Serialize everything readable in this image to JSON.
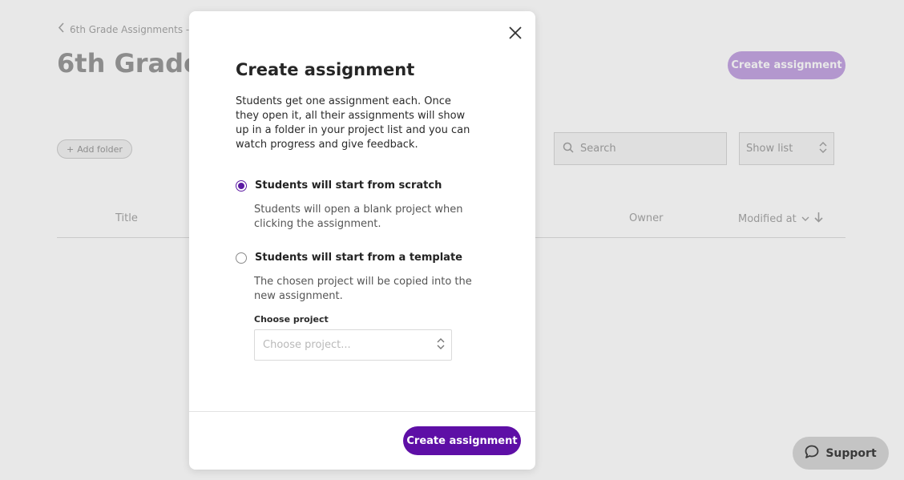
{
  "background": {
    "breadcrumb": "6th Grade Assignments - S",
    "page_title": "6th Grade -",
    "create_button": "Create assignment",
    "add_folder": "Add folder",
    "search_placeholder": "Search",
    "view_select": "Show list",
    "columns": {
      "title": "Title",
      "owner": "Owner",
      "modified": "Modified at"
    }
  },
  "support": {
    "label": "Support"
  },
  "modal": {
    "title": "Create assignment",
    "description": "Students get one assignment each. Once they open it, all their assignments will show up in a folder in your project list and you can watch progress and give feedback.",
    "options": [
      {
        "label": "Students will start from scratch",
        "description": "Students will open a blank project when clicking the assignment.",
        "selected": true
      },
      {
        "label": "Students will start from a template",
        "description": "The chosen project will be copied into the new assignment.",
        "selected": false
      }
    ],
    "choose_project_label": "Choose project",
    "choose_project_placeholder": "Choose project...",
    "submit_button": "Create assignment"
  },
  "colors": {
    "accent": "#5e0fa6",
    "accent_disabled": "#c5a6e3"
  }
}
